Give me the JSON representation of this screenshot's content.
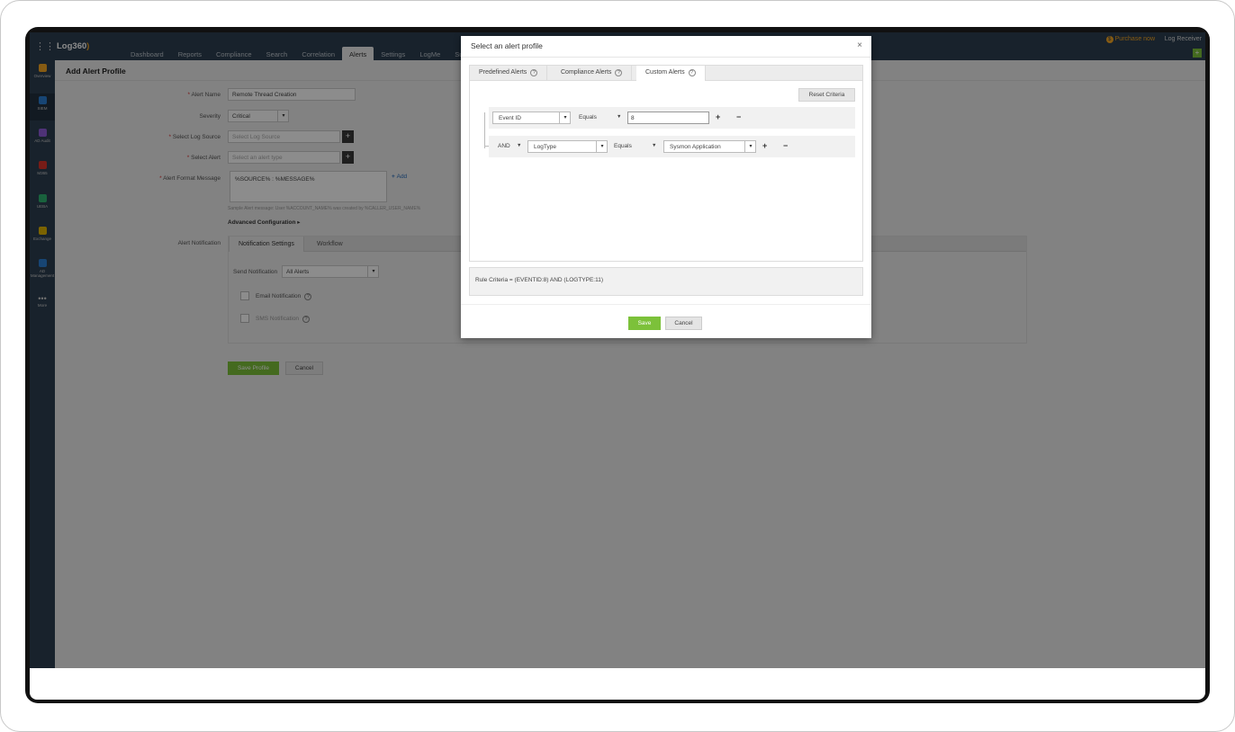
{
  "app": {
    "brand": "Log360"
  },
  "topnav": {
    "items": [
      "Dashboard",
      "Reports",
      "Compliance",
      "Search",
      "Correlation",
      "Alerts",
      "Settings",
      "LogMe",
      "Su"
    ],
    "active": "Alerts",
    "purchase": "Purchase now",
    "user": "Log Receiver"
  },
  "rail": {
    "items": [
      {
        "label": "Overview",
        "color": "#f5a623"
      },
      {
        "label": "SIEM",
        "color": "#2a7fd4"
      },
      {
        "label": "AD Audit",
        "color": "#8e5bd9"
      },
      {
        "label": "M365",
        "color": "#d9342b"
      },
      {
        "label": "UEBA",
        "color": "#2fb36f"
      },
      {
        "label": "Exchange",
        "color": "#e0b400"
      },
      {
        "label": "AD Management",
        "color": "#2a7fd4"
      },
      {
        "label": "More",
        "color": "#cccccc"
      }
    ]
  },
  "page": {
    "title": "Add Alert Profile",
    "alert_name_label": "Alert Name",
    "alert_name_value": "Remote Thread Creation",
    "severity_label": "Severity",
    "severity_value": "Critical",
    "log_source_label": "Select Log Source",
    "log_source_placeholder": "Select Log Source",
    "select_alert_label": "Select Alert",
    "select_alert_placeholder": "Select an alert type",
    "format_label": "Alert Format Message",
    "format_value": "%SOURCE% : %MESSAGE%",
    "add_link": "Add",
    "sample_text": "Sample Alert message: User %ACCOUNT_NAME% was created by %CALLER_USER_NAME%",
    "advanced": "Advanced Configuration",
    "notification_label": "Alert Notification",
    "notification_tabs": [
      "Notification Settings",
      "Workflow"
    ],
    "send_notification_label": "Send Notification",
    "send_notification_value": "All Alerts",
    "email_notification": "Email Notification",
    "sms_notification": "SMS Notification",
    "save_profile": "Save Profile",
    "cancel": "Cancel"
  },
  "modal": {
    "title": "Select an alert profile",
    "close": "×",
    "tabs": [
      "Predefined Alerts",
      "Compliance Alerts",
      "Custom Alerts"
    ],
    "active_tab": "Custom Alerts",
    "reset": "Reset Criteria",
    "row1": {
      "field": "Event ID",
      "operator": "Equals",
      "value": "8"
    },
    "row2": {
      "conjunction": "AND",
      "field": "LogType",
      "operator": "Equals",
      "value": "Sysmon Application"
    },
    "rule_criteria": "Rule Criteria = (EVENTID:8) AND (LOGTYPE:11)",
    "save": "Save",
    "cancel": "Cancel"
  },
  "colors": {
    "accent_green": "#7cc13a",
    "nav_bg": "#2c3e50",
    "purchase": "#f5a623"
  }
}
